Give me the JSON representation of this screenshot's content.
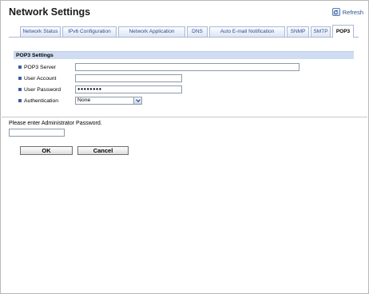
{
  "header": {
    "title": "Network Settings",
    "refresh_label": "Refresh"
  },
  "tabs": [
    {
      "label": "Network Status",
      "active": false
    },
    {
      "label": "IPv6 Configuration",
      "active": false
    },
    {
      "label": "Network Application",
      "active": false
    },
    {
      "label": "DNS",
      "active": false
    },
    {
      "label": "Auto E-mail Notification",
      "active": false
    },
    {
      "label": "SNMP",
      "active": false
    },
    {
      "label": "SMTP",
      "active": false
    },
    {
      "label": "POP3",
      "active": true
    }
  ],
  "pop3": {
    "section_title": "POP3 Settings",
    "server": {
      "label": "POP3 Server",
      "value": ""
    },
    "account": {
      "label": "User Account",
      "value": ""
    },
    "password": {
      "label": "User Password",
      "value": "●●●●●●●●"
    },
    "authentication": {
      "label": "Authentication",
      "value": "None"
    }
  },
  "admin": {
    "prompt": "Please enter Administrator Password.",
    "value": ""
  },
  "actions": {
    "ok_label": "OK",
    "cancel_label": "Cancel"
  },
  "colors": {
    "accent": "#2e4f8c",
    "section_bg": "#cfdcf1",
    "bullet": "#3a5ea8"
  }
}
